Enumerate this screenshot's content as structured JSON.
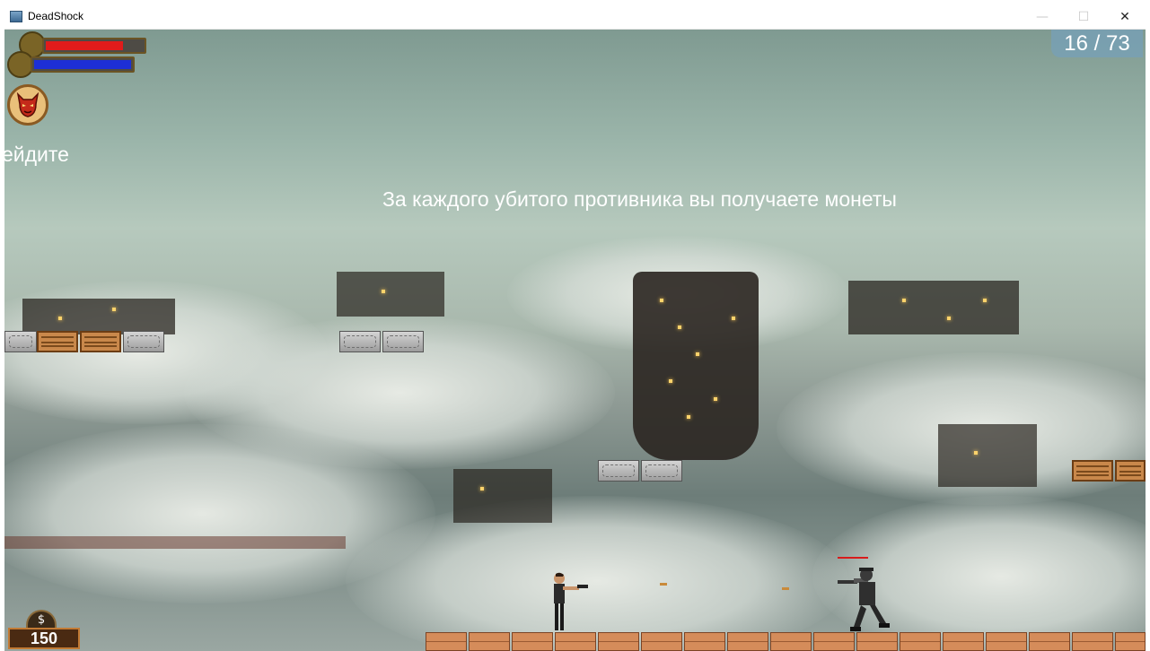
{
  "window": {
    "title": "DeadShock",
    "minimize_glyph": "—",
    "maximize_glyph": "☐",
    "close_glyph": "✕"
  },
  "hud": {
    "health_level": 0.8,
    "mana_level": 1.0,
    "health_color": "#e11b1b",
    "mana_color": "#1d2fd6",
    "ability_icon": "demon-face-icon",
    "progress_counter": "16 / 73",
    "coins_icon": "dollar-emblem-icon",
    "coins_symbol": "$",
    "coins": "150"
  },
  "messages": {
    "left_fragment": "ейдите",
    "tutorial": "За каждого убитого противника вы получаете монеты"
  },
  "colors": {
    "enemy_health": "#d81b1b",
    "platform_stone": "#b5b5b5",
    "platform_crate": "#c9884b",
    "floor_brick": "#d58c5a"
  }
}
